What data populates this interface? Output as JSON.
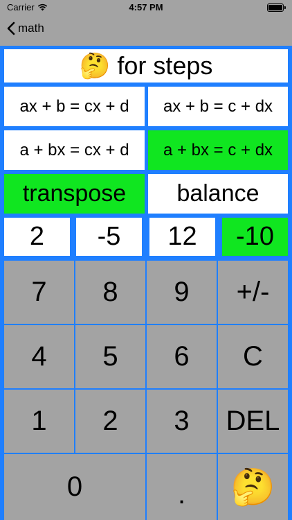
{
  "status": {
    "carrier": "Carrier",
    "time": "4:57 PM"
  },
  "nav": {
    "back_label": "math"
  },
  "steps": {
    "emoji": "🤔",
    "label": "for steps"
  },
  "equations": [
    {
      "label": "ax + b = cx + d",
      "selected": false
    },
    {
      "label": "ax + b = c + dx",
      "selected": false
    },
    {
      "label": "a + bx = cx + d",
      "selected": false
    },
    {
      "label": "a + bx = c + dx",
      "selected": true
    }
  ],
  "methods": [
    {
      "label": "transpose",
      "selected": true
    },
    {
      "label": "balance",
      "selected": false
    }
  ],
  "values": [
    {
      "label": "2",
      "selected": false
    },
    {
      "label": "-5",
      "selected": false
    },
    {
      "label": "12",
      "selected": false
    },
    {
      "label": "-10",
      "selected": true
    }
  ],
  "keypad": {
    "k7": "7",
    "k8": "8",
    "k9": "9",
    "sign": "+/-",
    "k4": "4",
    "k5": "5",
    "k6": "6",
    "clear": "C",
    "k1": "1",
    "k2": "2",
    "k3": "3",
    "del": "DEL",
    "k0": "0",
    "dot": ".",
    "think_emoji": "🤔"
  },
  "colors": {
    "accent_blue": "#1f7fff",
    "selected_green": "#10e620",
    "key_gray": "#a3a3a3"
  }
}
